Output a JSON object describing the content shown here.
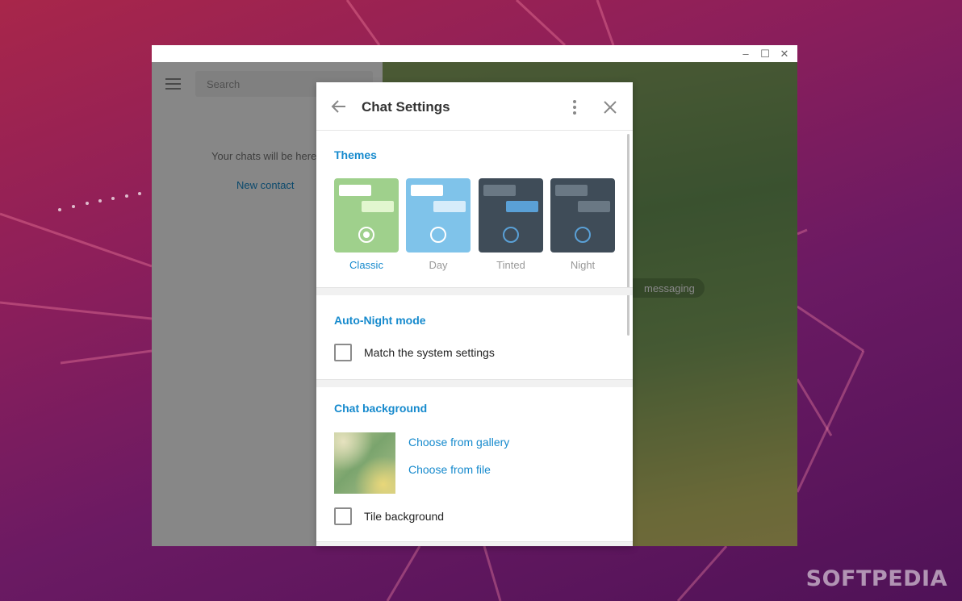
{
  "window": {
    "controls": [
      "–",
      "☐",
      "✕"
    ]
  },
  "sidebar": {
    "search_placeholder": "Search",
    "empty_text": "Your chats will be here",
    "new_contact": "New contact"
  },
  "chat": {
    "service_message": "messaging"
  },
  "panel": {
    "title": "Chat Settings",
    "themes": {
      "title": "Themes",
      "items": [
        {
          "label": "Classic",
          "selected": true,
          "bg": "#9fd08c",
          "bubble_in": "#ffffff",
          "bubble_out": "#e2f6cf",
          "ring": "#ffffff",
          "label_color": "#168acd"
        },
        {
          "label": "Day",
          "selected": false,
          "bg": "#7fc3ea",
          "bubble_in": "#ffffff",
          "bubble_out": "#d6ecfa",
          "ring": "#ffffff",
          "label_color": "#999999"
        },
        {
          "label": "Tinted",
          "selected": false,
          "bg": "#3f4c58",
          "bubble_in": "#6a7884",
          "bubble_out": "#5aa0d6",
          "ring": "#5aa0d6",
          "label_color": "#999999"
        },
        {
          "label": "Night",
          "selected": false,
          "bg": "#3f4c58",
          "bubble_in": "#6a7884",
          "bubble_out": "#6a7884",
          "ring": "#5aa0d6",
          "label_color": "#999999"
        }
      ]
    },
    "auto_night": {
      "title": "Auto-Night mode",
      "match_system": "Match the system settings",
      "match_system_checked": false
    },
    "background": {
      "title": "Chat background",
      "choose_gallery": "Choose from gallery",
      "choose_file": "Choose from file",
      "tile": "Tile background",
      "tile_checked": false
    }
  },
  "watermark": "SOFTPEDIA"
}
